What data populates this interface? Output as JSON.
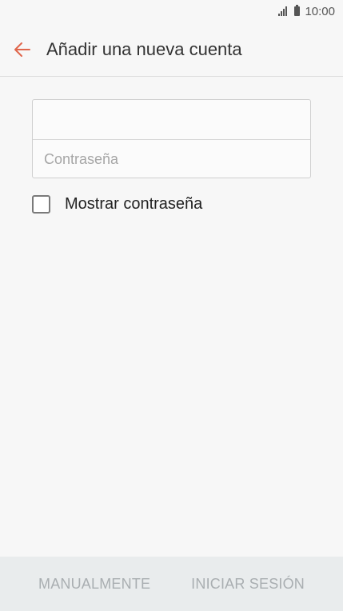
{
  "status_bar": {
    "time": "10:00",
    "icons": [
      "signal-icon",
      "battery-icon"
    ]
  },
  "app_bar": {
    "title": "Añadir una nueva cuenta",
    "back_icon": "arrow-left-icon",
    "accent_color": "#e0664c"
  },
  "form": {
    "email": {
      "value": "",
      "placeholder": ""
    },
    "password": {
      "value": "",
      "placeholder": "Contraseña"
    },
    "show_password": {
      "label": "Mostrar contraseña",
      "checked": false
    }
  },
  "bottom_bar": {
    "manual_label": "MANUALMENTE",
    "sign_in_label": "INICIAR SESIÓN"
  }
}
